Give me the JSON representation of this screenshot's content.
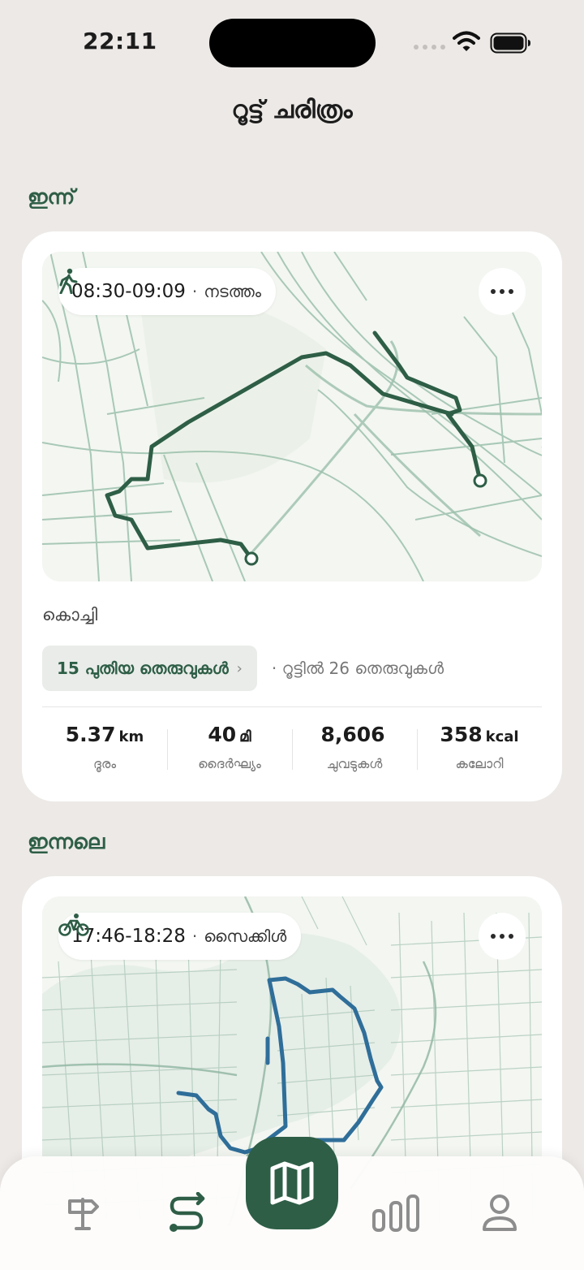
{
  "status": {
    "time": "22:11"
  },
  "header": {
    "title": "റൂട്ട് ചരിത്രം"
  },
  "sections": [
    {
      "label": "ഇന്ന്",
      "route": {
        "time": "08:30-09:09",
        "separator": "·",
        "activity": "നടത്തം",
        "activity_icon": "walk-icon",
        "city": "കൊച്ചി",
        "new_streets": "15 പുതിയ തെരുവുകൾ",
        "chevron": "›",
        "total_streets": "· റൂട്ടിൽ 26 തെരുവുകൾ",
        "route_color": "#2e5e46",
        "stats": [
          {
            "value": "5.37",
            "unit": "km",
            "label": "ദൂരം"
          },
          {
            "value": "40",
            "unit": "മി",
            "label": "ദൈർഘ്യം"
          },
          {
            "value": "8,606",
            "unit": "",
            "label": "ചുവടുകൾ"
          },
          {
            "value": "358",
            "unit": "kcal",
            "label": "കലോറി"
          }
        ]
      }
    },
    {
      "label": "ഇന്നലെ",
      "route": {
        "time": "17:46-18:28",
        "separator": "·",
        "activity": "സൈക്കിൾ",
        "activity_icon": "bike-icon",
        "route_color": "#2f6e99"
      }
    }
  ],
  "tabbar": {
    "items": [
      "signpost-icon",
      "route-icon",
      "map-icon",
      "stats-icon",
      "profile-icon"
    ],
    "active": "route-icon",
    "accent": "#2e5e46"
  }
}
